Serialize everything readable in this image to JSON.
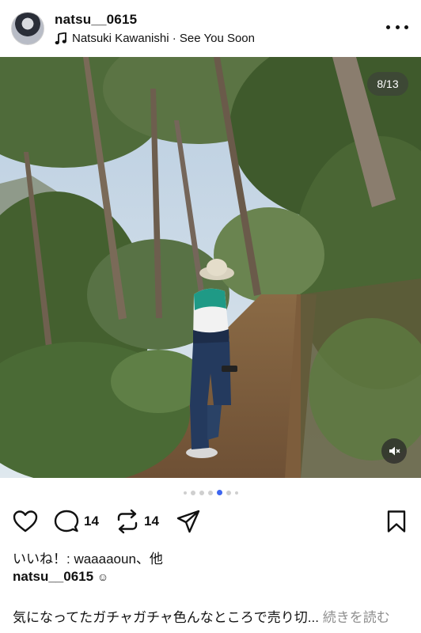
{
  "header": {
    "username": "natsu__0615",
    "music": "Natsuki Kawanishi · See You Soon"
  },
  "photo": {
    "counter": "8/13"
  },
  "pagination": {
    "total_visible_dots": 7,
    "active_index": 4
  },
  "actions": {
    "comments_count": "14",
    "reposts_count": "14"
  },
  "likes": {
    "text": "いいね！: waaaaoun、他"
  },
  "caption": {
    "username": "natsu__0615",
    "emoji": "☺",
    "text": "気になってたガチャガチャ色んなところで売り切...",
    "more_label": "続きを読む"
  },
  "colors": {
    "accent": "#3d66f0"
  },
  "icons": [
    "avatar",
    "music-note-icon",
    "more-icon",
    "mute-icon",
    "heart-icon",
    "comment-icon",
    "repost-icon",
    "share-icon",
    "bookmark-icon"
  ]
}
